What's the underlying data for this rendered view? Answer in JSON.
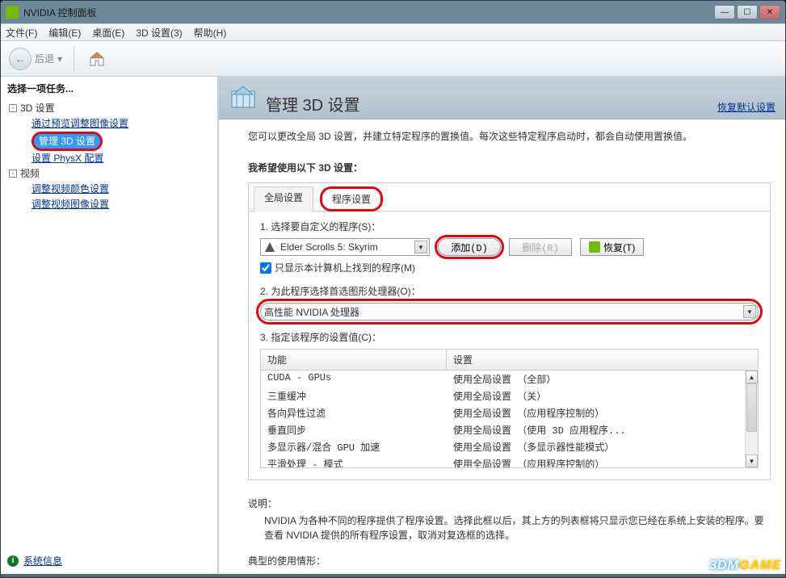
{
  "window": {
    "title": "NVIDIA 控制面板"
  },
  "menubar": {
    "file": "文件(F)",
    "edit": "编辑(E)",
    "desktop": "桌面(E)",
    "settings3d": "3D 设置(3)",
    "help": "帮助(H)"
  },
  "toolbar": {
    "back": "后退",
    "back_arrow": "←",
    "dropdown": "▾"
  },
  "sidebar": {
    "title": "选择一项任务...",
    "tree": {
      "root1": "3D 设置",
      "item1": "通过预览调整图像设置",
      "item2": "管理 3D 设置",
      "item3": "设置 PhysX 配置",
      "root2": "视频",
      "item4": "调整视频颜色设置",
      "item5": "调整视频图像设置"
    },
    "sysinfo": "系统信息",
    "sysinfo_glyph": "i"
  },
  "header": {
    "title": "管理 3D 设置",
    "restore": "恢复默认设置"
  },
  "content": {
    "intro": "您可以更改全局 3D 设置，并建立特定程序的置换值。每次这些特定程序启动时，都会自动使用置换值。",
    "section_title": "我希望使用以下 3D 设置：",
    "tabs": {
      "global": "全局设置",
      "program": "程序设置"
    },
    "step1": {
      "label": "1. 选择要自定义的程序(S)：",
      "program": "Elder Scrolls 5: Skyrim",
      "add": "添加(D)",
      "remove": "删除(R)",
      "restore": "恢复(T)",
      "checkbox": "只显示本计算机上找到的程序(M)"
    },
    "step2": {
      "label": "2. 为此程序选择首选图形处理器(O)：",
      "value": "高性能 NVIDIA 处理器"
    },
    "step3": {
      "label": "3. 指定该程序的设置值(C)：",
      "col_feature": "功能",
      "col_setting": "设置",
      "rows": [
        {
          "feature": "CUDA - GPUs",
          "setting": "使用全局设置 （全部）"
        },
        {
          "feature": "三重缓冲",
          "setting": "使用全局设置 （关）"
        },
        {
          "feature": "各向异性过滤",
          "setting": "使用全局设置 （应用程序控制的）"
        },
        {
          "feature": "垂直同步",
          "setting": "使用全局设置 （使用 3D 应用程序..."
        },
        {
          "feature": "多显示器/混合 GPU 加速",
          "setting": "使用全局设置 （多显示器性能模式）"
        },
        {
          "feature": "平滑处理 - 模式",
          "setting": "使用全局设置 （应用程序控制的）"
        }
      ]
    },
    "desc_label": "说明：",
    "desc_text": "NVIDIA 为各种不同的程序提供了程序设置。选择此框以后，其上方的列表框将只显示您已经在系统上安装的程序。要查看 NVIDIA 提供的所有程序设置，取消对复选框的选择。",
    "usage_label": "典型的使用情形："
  },
  "watermark": {
    "p1": "3DM",
    "p2": "GAME"
  }
}
